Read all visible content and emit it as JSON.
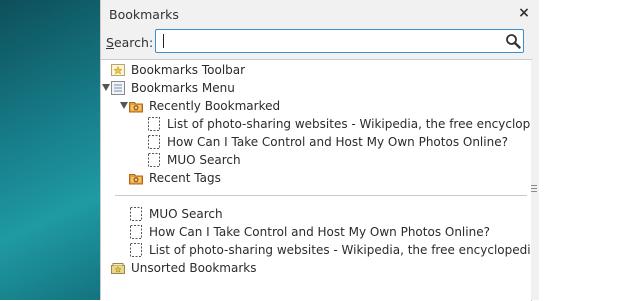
{
  "sidebar": {
    "title": "Bookmarks",
    "close_glyph": "×",
    "search": {
      "label_accel": "S",
      "label_rest": "earch:",
      "value": "",
      "placeholder": ""
    },
    "icons": {
      "search": "magnifier-icon",
      "folder": "folder-icon",
      "bookmark": "bookmark-page-icon"
    },
    "tree": {
      "toolbar": "Bookmarks Toolbar",
      "menu": "Bookmarks Menu",
      "recently_bookmarked": "Recently Bookmarked",
      "recent_items": [
        "List of photo-sharing websites - Wikipedia, the free encyclopedia",
        "How Can I Take Control and Host My Own Photos Online?",
        "MUO Search"
      ],
      "recent_tags": "Recent Tags",
      "menu_items": [
        "MUO Search",
        "How Can I Take Control and Host My Own Photos Online?",
        "List of photo-sharing websites - Wikipedia, the free encyclopedia"
      ],
      "unsorted": "Unsorted Bookmarks"
    }
  }
}
